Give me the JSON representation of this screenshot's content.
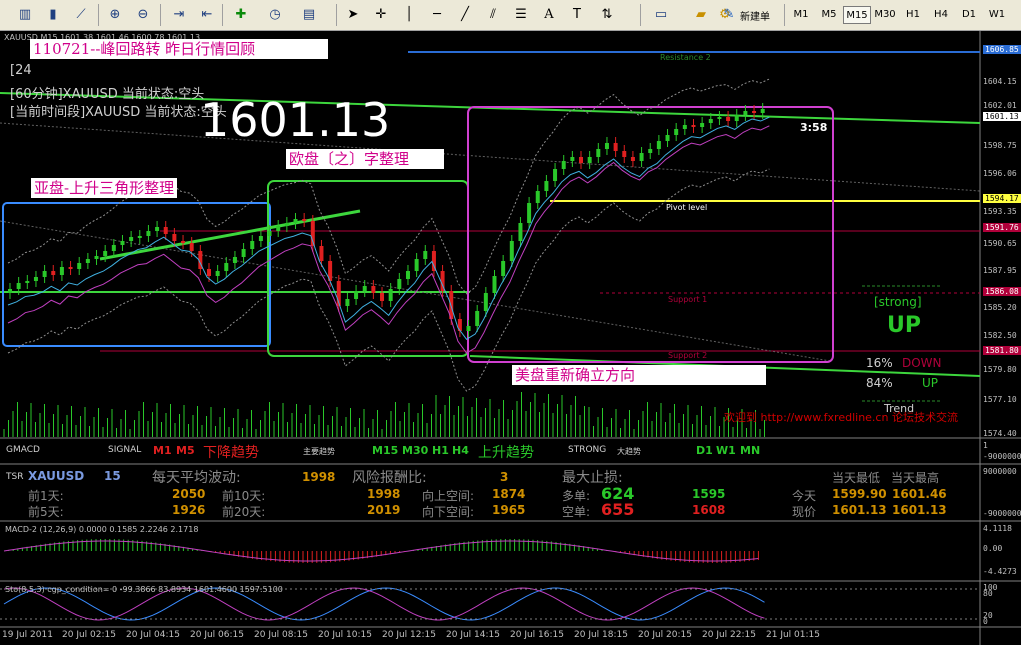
{
  "toolbar": {
    "new_order_label": "新建单",
    "timeframes": [
      "M1",
      "M5",
      "M15",
      "M30",
      "H1",
      "H4",
      "D1",
      "W1"
    ],
    "active_timeframe": "M15"
  },
  "chart": {
    "title_line": "XAUUSD,M15 1601.38 1601.46 1600.78 1601.13",
    "symbol": "XAUUSD",
    "big_price": "1601.13",
    "countdown": "3:58",
    "info_line1": "[24",
    "info_line2": "[60分钟]XAUUSD 当前状态:空头",
    "info_line3": "[当前时间段]XAUUSD 当前状态:空头",
    "resistance2": "Resistance 2",
    "pivot": "Pivot level",
    "support1": "Support 1",
    "support2": "Support 2",
    "strong_label": "[strong]",
    "up_label": "UP",
    "down_pct": "16%",
    "down_label": "DOWN",
    "up_pct": "84%",
    "up_small": "UP",
    "trend_label": "Trend",
    "watermark": "欢迎到 http://www.fxredline.cn 论坛技术交流",
    "annotations": {
      "title": "110721--峰回路转  昨日行情回顾",
      "asia": "亚盘-上升三角形整理",
      "europe": "欧盘〔之〕字整理",
      "us": "美盘重新确立方向"
    },
    "price_labels": [
      "1606.85",
      "1604.15",
      "1602.01",
      "1601.13",
      "1598.75",
      "1596.06",
      "1594.17",
      "1593.35",
      "1591.76",
      "1590.65",
      "1587.95",
      "1586.08",
      "1585.20",
      "1582.50",
      "1581.80",
      "1579.80",
      "1577.10",
      "1574.40"
    ],
    "time_labels": [
      "19 Jul 2011",
      "20 Jul 02:15",
      "20 Jul 04:15",
      "20 Jul 06:15",
      "20 Jul 08:15",
      "20 Jul 10:15",
      "20 Jul 12:15",
      "20 Jul 14:15",
      "20 Jul 16:15",
      "20 Jul 18:15",
      "20 Jul 20:15",
      "20 Jul 22:15",
      "21 Jul 01:15"
    ]
  },
  "gmacd": {
    "name": "GMACD",
    "signal": "SIGNAL",
    "m1": "M1",
    "m5": "M5",
    "down_trend": "下降趋势",
    "main_trend": "主要趋势",
    "m15": "M15",
    "m30": "M30",
    "h1": "H1",
    "h4": "H4",
    "up_trend": "上升趋势",
    "strong": "STRONG",
    "big_trend": "大趋势",
    "d1": "D1",
    "w1": "W1",
    "mn": "MN",
    "axis_top": "1",
    "axis_bot": "-9000000"
  },
  "tsr": {
    "name": "TSR",
    "symbol": "XAUUSD",
    "period": "15",
    "avg_label": "每天平均波动:",
    "avg_value": "1998",
    "risk_label": "风险报酬比:",
    "risk_value": "3",
    "maxstop_label": "最大止损:",
    "low_label": "当天最低",
    "high_label": "当天最高",
    "prev1_label": "前1天:",
    "prev1_value": "2050",
    "prev10_label": "前10天:",
    "prev10_value": "1998",
    "up_space_label": "向上空间:",
    "up_space_value": "1874",
    "buy_label": "多单:",
    "buy_value": "624",
    "buy_pts": "1595",
    "today_label": "今天",
    "today_low": "1599.90",
    "today_high": "1601.46",
    "prev5_label": "前5天:",
    "prev5_value": "1926",
    "prev20_label": "前20天:",
    "prev20_value": "2019",
    "down_space_label": "向下空间:",
    "down_space_value": "1965",
    "sell_label": "空单:",
    "sell_value": "655",
    "sell_pts": "1608",
    "now_label": "现价",
    "now_low": "1601.13",
    "now_high": "1601.13",
    "axis_top": "9000000",
    "axis_bot": "-9000000"
  },
  "macd": {
    "label": "MACD-2 (12,26,9) 0.0000 0.1585 2.2246 2.1718",
    "axis": [
      "4.1118",
      "0.00",
      "-4.4273"
    ]
  },
  "sto": {
    "label": "Sto(8,5,3) cgp_condition= 0 -99.3866 83.8934 1601.4600 1597.5100",
    "axis": [
      "100",
      "80",
      "20",
      "0"
    ]
  }
}
